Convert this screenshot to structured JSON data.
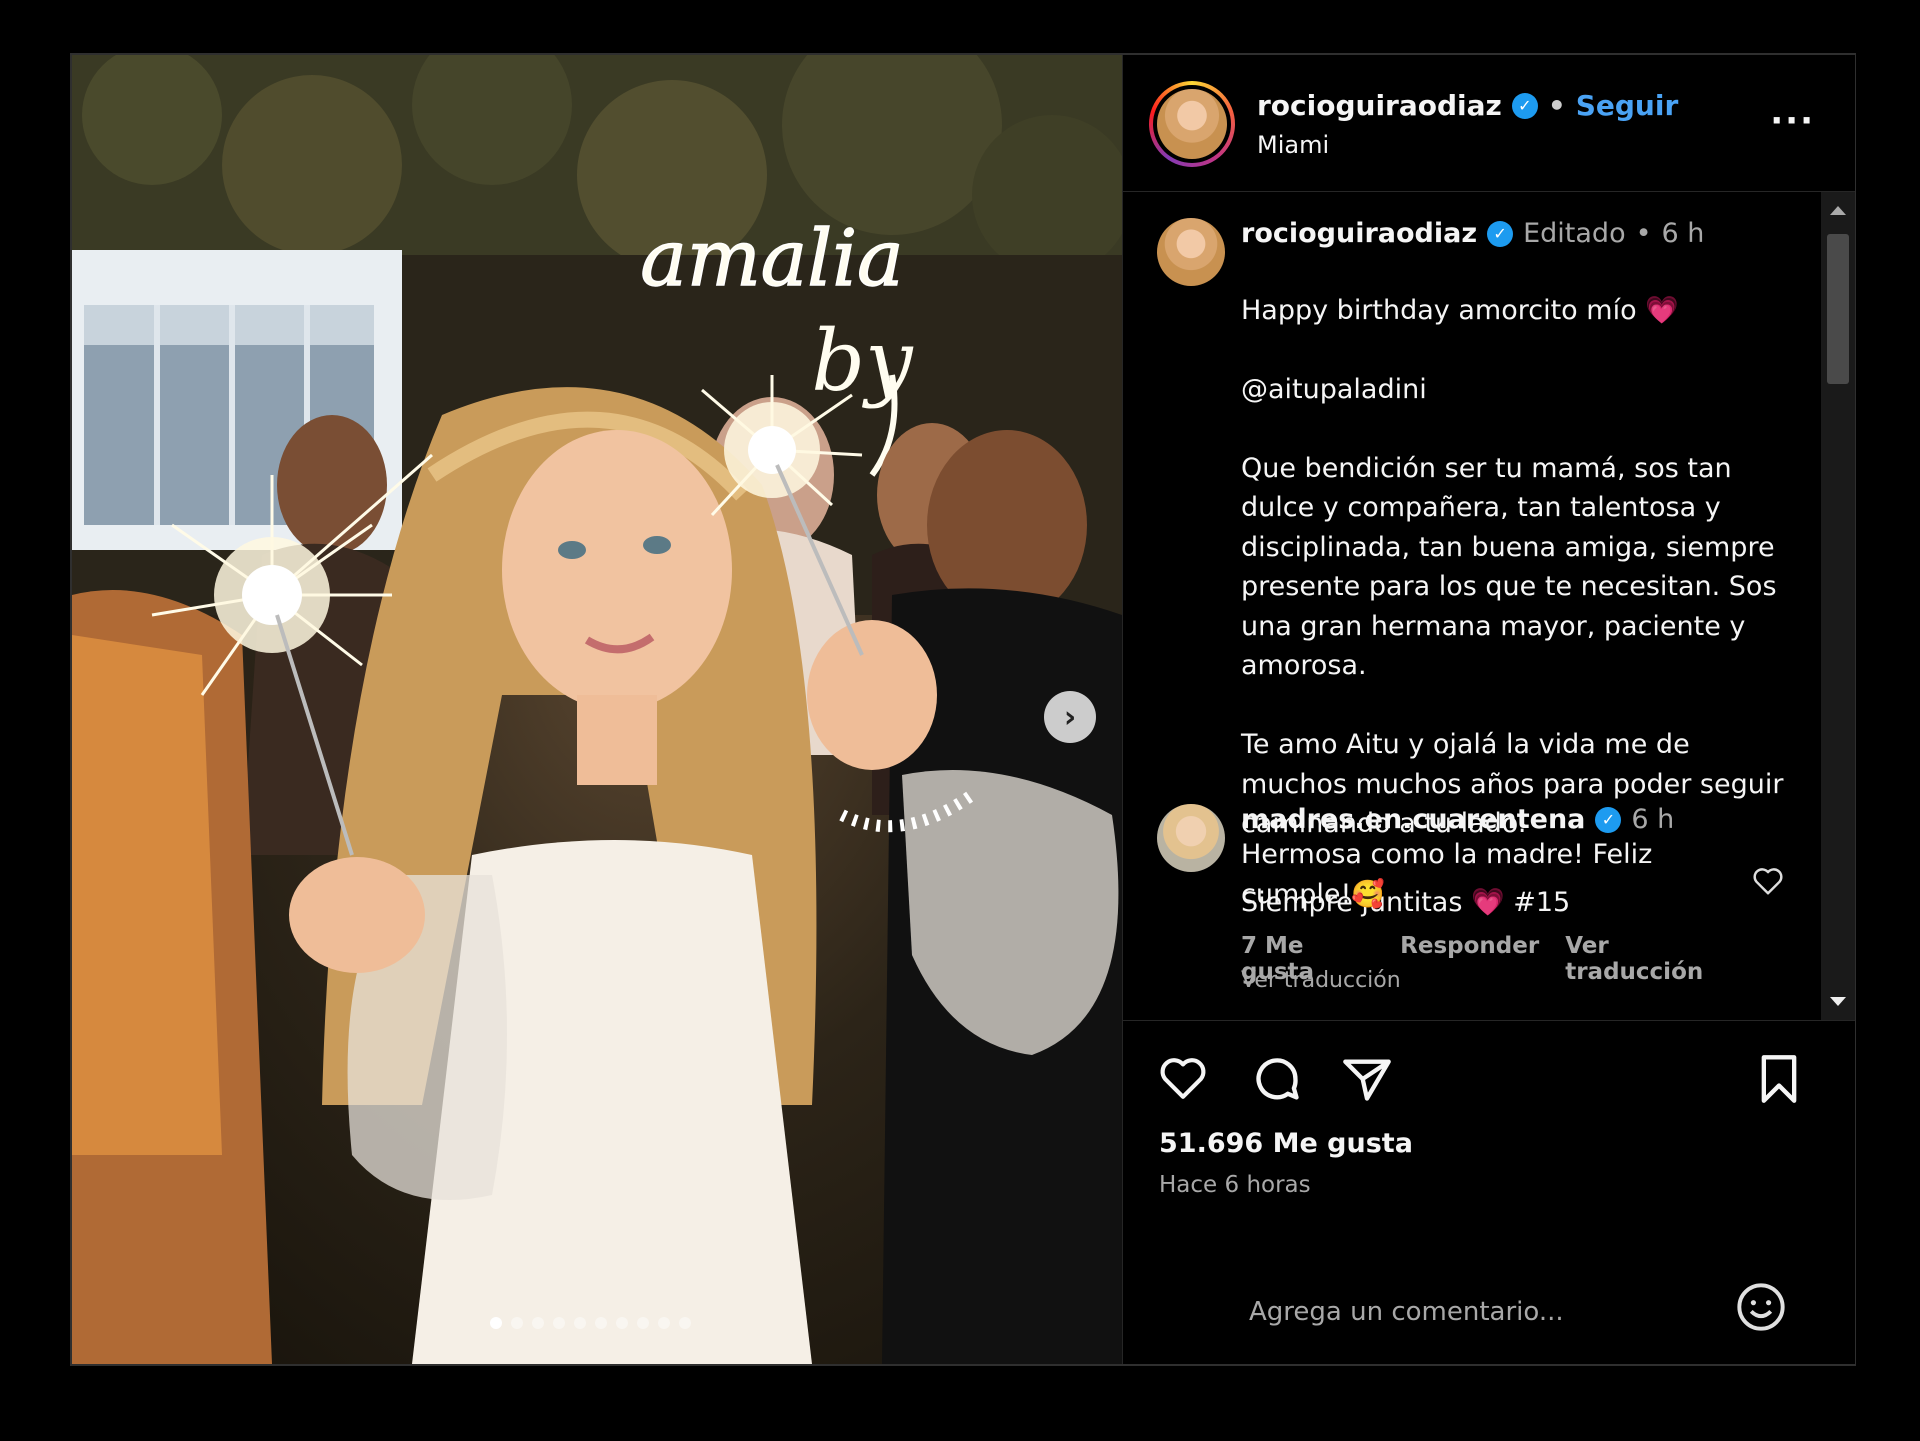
{
  "post": {
    "author": {
      "username": "rocioguiraodiaz",
      "verified_icon": "verified-badge-icon",
      "follow_label": "Seguir",
      "location": "Miami"
    },
    "more_icon": "more-options-icon",
    "caption": {
      "username": "rocioguiraodiaz",
      "edited": "Editado",
      "time": "6 h",
      "lines": [
        "Happy birthday amorcito mío",
        "@aitupaladini",
        "Que bendición ser tu mamá, sos tan dulce y compañera, tan talentosa y disciplinada, tan buena amiga, siempre presente para los que te necesitan. Sos una gran hermana mayor, paciente y amorosa.",
        "Te amo Aitu y ojalá la vida me de muchos muchos años para poder seguir caminando a tu lado.",
        "Siempre juntitas",
        "#15"
      ],
      "heart_emoji": "💗",
      "see_translation": "Ver traducción"
    },
    "comment": {
      "username": "madres.en.cuarentena",
      "time": "6 h",
      "text": "Hermosa como la madre! Feliz cumple!",
      "emoji": "🥰",
      "likes": "7 Me gusta",
      "reply": "Responder",
      "see_translation": "Ver traducción",
      "like_icon": "heart-outline-icon"
    },
    "likes": "51.696 Me gusta",
    "time_ago": "Hace 6 horas",
    "add_comment_placeholder": "Agrega un comentario...",
    "photo": {
      "neon_sign": "amalia",
      "neon_sign_2": "by",
      "carousel_total": 10,
      "carousel_active": 1
    }
  }
}
